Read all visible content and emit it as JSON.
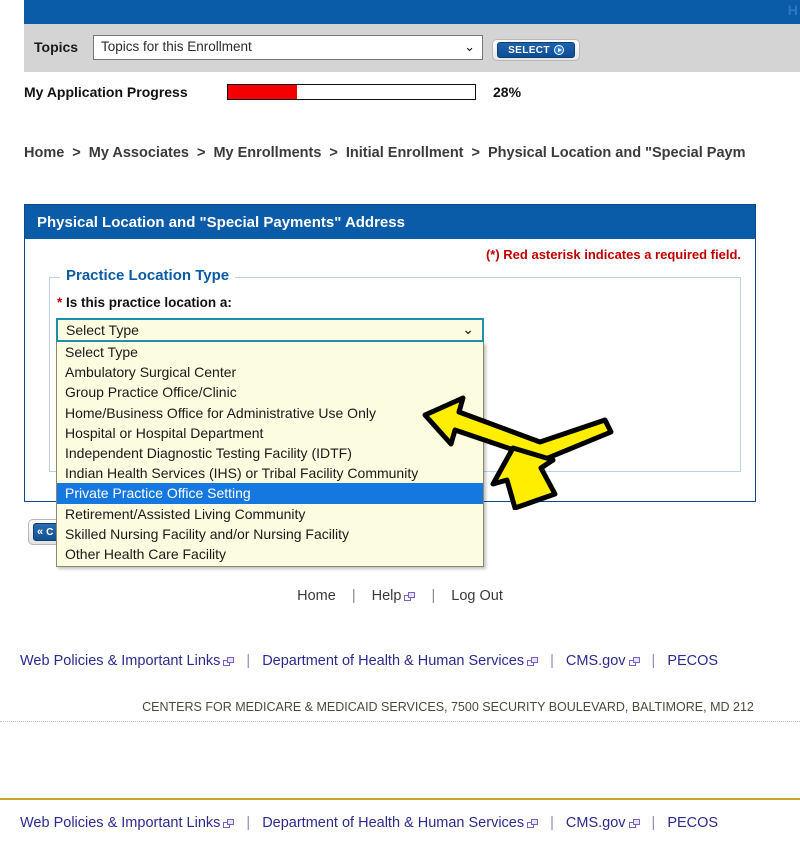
{
  "topbar": {
    "right_text": "H"
  },
  "topics": {
    "label": "Topics",
    "selected": "Topics for this Enrollment",
    "caret": "⌄",
    "select_button": "SELECT"
  },
  "progress": {
    "label": "My Application Progress",
    "percent_text": "28%",
    "percent_value": 28,
    "fill_color": "#f50000"
  },
  "breadcrumb": {
    "items": [
      "Home",
      "My Associates",
      "My Enrollments",
      "Initial Enrollment",
      "Physical Location and \"Special Paym"
    ],
    "separator": ">"
  },
  "panel": {
    "title": "Physical Location and \"Special Payments\" Address",
    "required_note": "(*) Red asterisk indicates a required field.",
    "fieldset_legend": "Practice Location Type",
    "field_required_marker": "*",
    "field_label": "Is this practice location a:"
  },
  "combo": {
    "value": "Select Type",
    "caret": "⌄",
    "options": [
      "Select Type",
      "Ambulatory Surgical Center",
      "Group Practice Office/Clinic",
      "Home/Business Office for Administrative Use Only",
      "Hospital or Hospital Department",
      "Independent Diagnostic Testing Facility (IDTF)",
      "Indian Health Services (IHS) or Tribal Facility Community",
      "Private Practice Office Setting",
      "Retirement/Assisted Living Community",
      "Skilled Nursing Facility and/or Nursing Facility",
      "Other Health Care Facility"
    ],
    "selected_index": 7,
    "highlight_color": "#1578e0",
    "background_color": "#fcfce0",
    "focus_border_color": "#1f8fb0"
  },
  "back_button": {
    "chevrons": "«",
    "label": "C"
  },
  "mid_links": {
    "home": "Home",
    "help": "Help",
    "log_out": "Log Out",
    "separator": "|"
  },
  "footer_links": {
    "items": [
      "Web Policies & Important Links",
      "Department of Health & Human Services",
      "CMS.gov",
      "PECOS"
    ],
    "separator": "|",
    "link_color": "#2b2b8f"
  },
  "cms_address": "CENTERS FOR MEDICARE & MEDICAID SERVICES, 7500 SECURITY BOULEVARD, BALTIMORE, MD 212",
  "theme": {
    "header_blue": "#0a5ca8",
    "gold_rule": "#c9a227",
    "required_red": "#c00000",
    "annotation_yellow": "#ffee00"
  }
}
